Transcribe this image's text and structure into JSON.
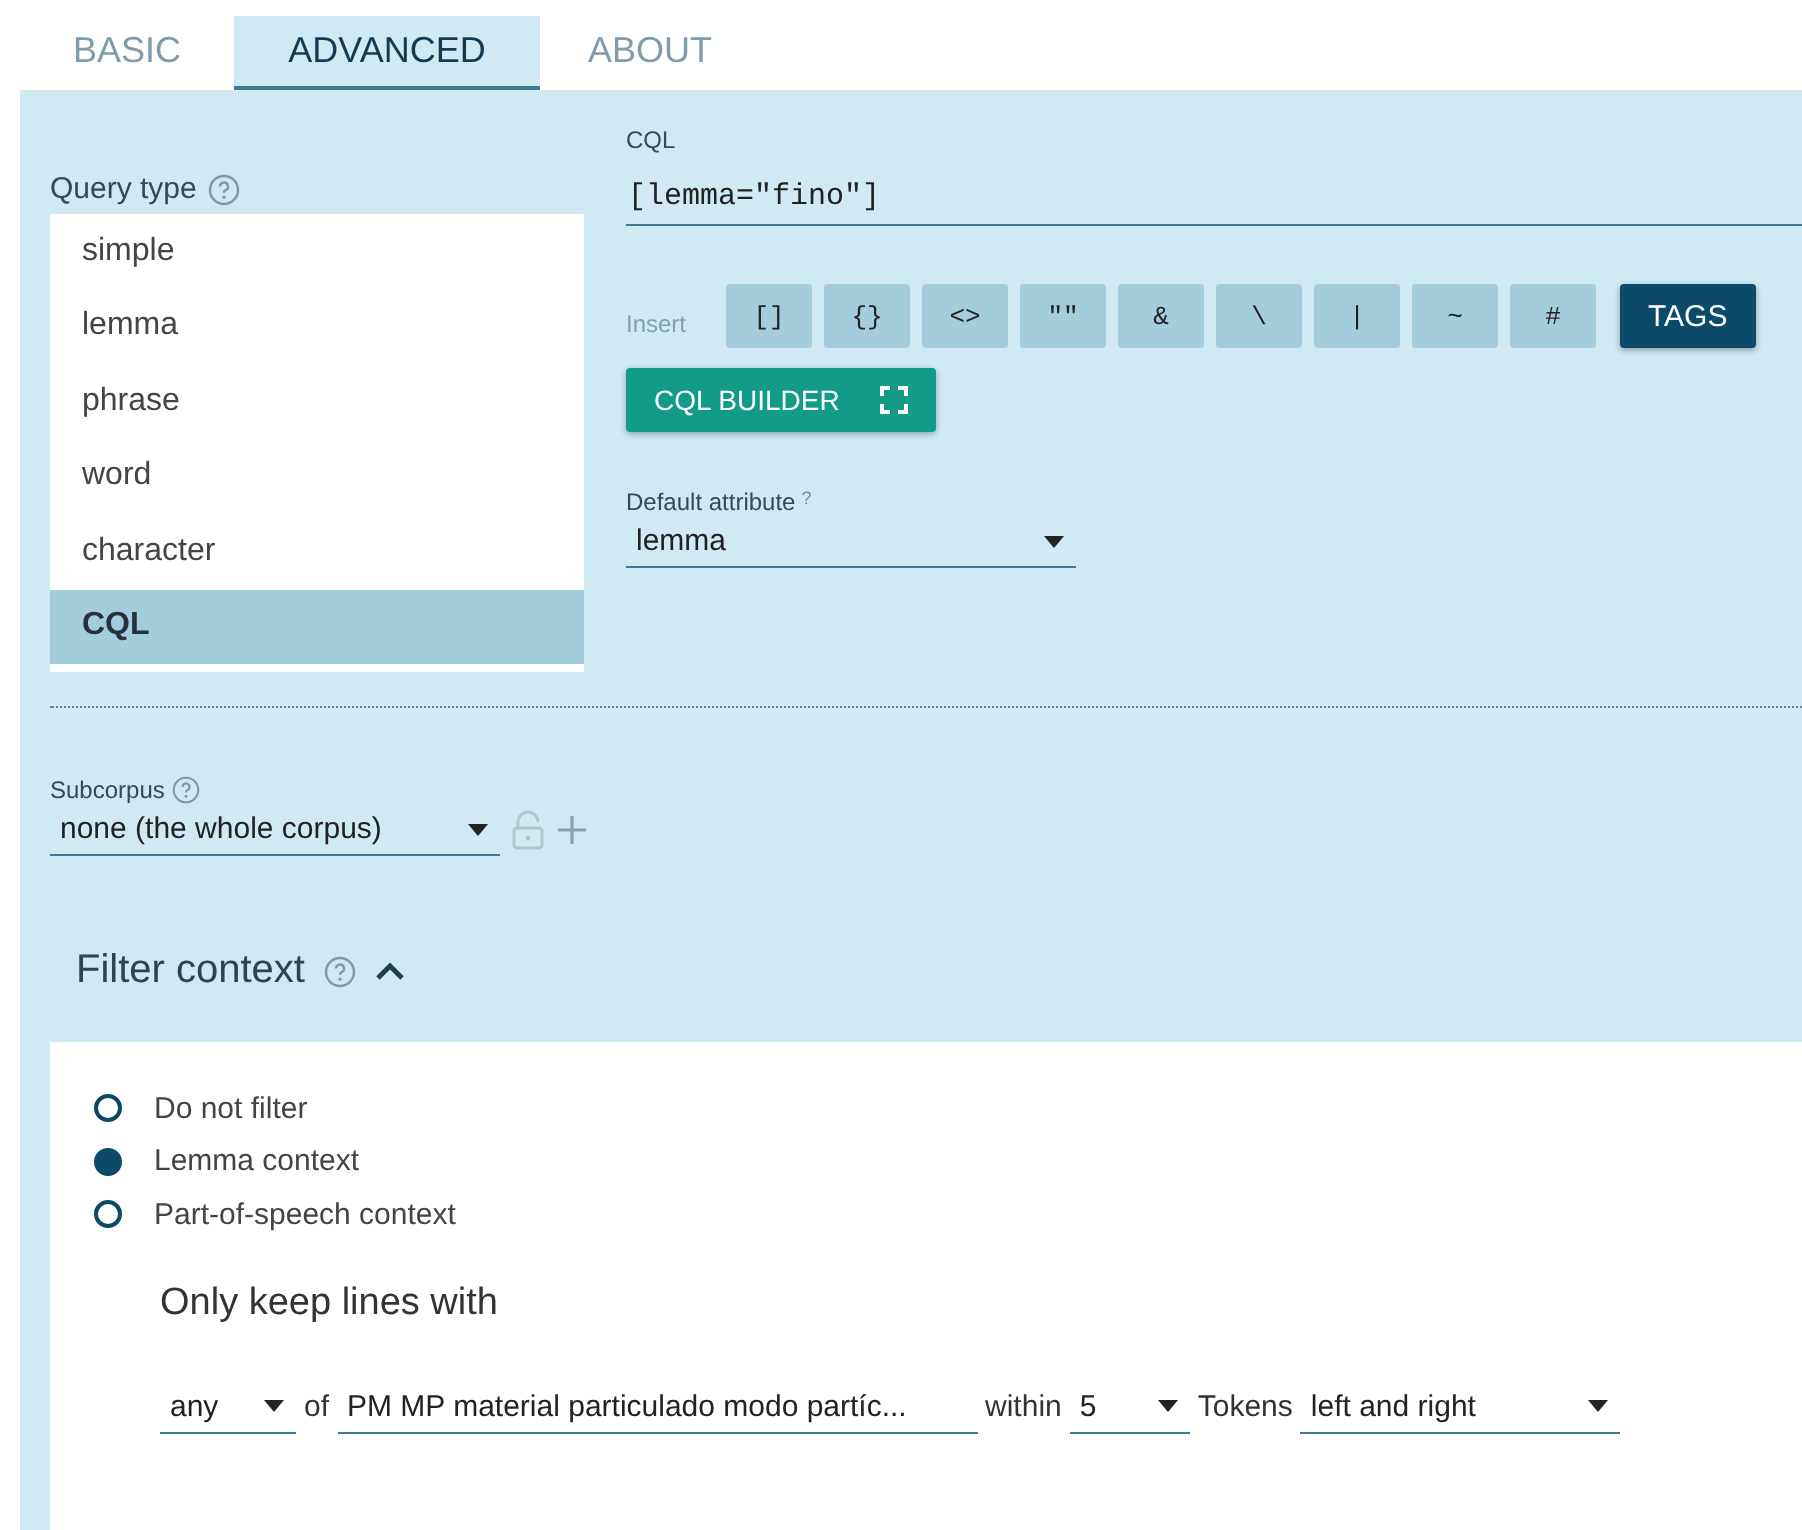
{
  "tabs": [
    {
      "label": "BASIC",
      "selected": false
    },
    {
      "label": "ADVANCED",
      "selected": true
    },
    {
      "label": "ABOUT",
      "selected": false
    }
  ],
  "query_type": {
    "label": "Query type",
    "options": [
      {
        "label": "simple",
        "selected": false
      },
      {
        "label": "lemma",
        "selected": false
      },
      {
        "label": "phrase",
        "selected": false
      },
      {
        "label": "word",
        "selected": false
      },
      {
        "label": "character",
        "selected": false
      },
      {
        "label": "CQL",
        "selected": true
      }
    ]
  },
  "cql": {
    "label": "CQL",
    "value": "[lemma=\"fino\"]"
  },
  "insert": {
    "label": "Insert",
    "symbols": [
      "[]",
      "{}",
      "<>",
      "\"\"",
      "&",
      "\\",
      "|",
      "~",
      "#"
    ],
    "tags_button": "TAGS"
  },
  "cql_builder_button": "CQL BUILDER",
  "default_attribute": {
    "label": "Default attribute",
    "hint": "?",
    "value": "lemma"
  },
  "subcorpus": {
    "label": "Subcorpus",
    "value": "none (the whole corpus)"
  },
  "filter_context": {
    "title": "Filter context",
    "expanded": true,
    "options": [
      {
        "label": "Do not filter",
        "selected": false
      },
      {
        "label": "Lemma context",
        "selected": true
      },
      {
        "label": "Part-of-speech context",
        "selected": false
      }
    ],
    "subtitle": "Only keep lines with",
    "row": {
      "quantifier": "any",
      "of": "of",
      "lemmas": "PM MP material particulado modo partíc...",
      "within": "within",
      "distance": "5",
      "tokens": "Tokens",
      "direction": "left and right"
    }
  }
}
